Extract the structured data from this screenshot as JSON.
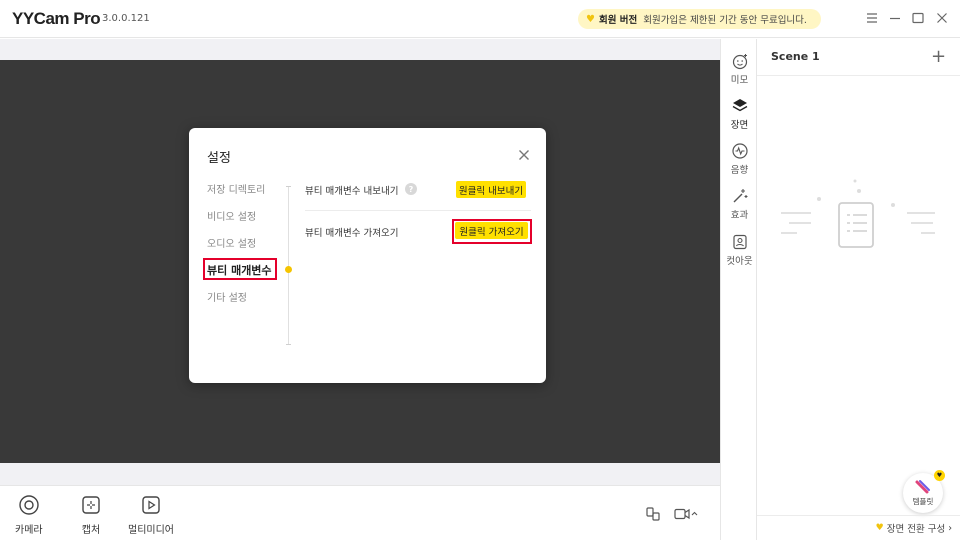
{
  "app": {
    "name": "YYCam Pro",
    "version": "3.0.0.121"
  },
  "banner": {
    "title": "회원 버전",
    "text": "회원가입은 제한된 기간 동안 무료입니다."
  },
  "bottombar": {
    "camera": "카메라",
    "capture": "캡처",
    "multimedia": "멀티미디어"
  },
  "sidenav": {
    "beauty": "미모",
    "scene": "장면",
    "audio": "음향",
    "effects": "효과",
    "cutout": "컷아웃"
  },
  "scene_panel": {
    "title": "Scene 1",
    "add": "+",
    "template_label": "템플릿",
    "footer": "장면 전환 구성"
  },
  "dialog": {
    "title": "설정",
    "menu": [
      "저장 디렉토리",
      "비디오 설정",
      "오디오 설정",
      "뷰티 매개변수",
      "기타 설정"
    ],
    "active_menu_index": 3,
    "export_label": "뷰티 매개변수 내보내기",
    "export_button": "원클릭 내보내기",
    "import_label": "뷰티 매개변수 가져오기",
    "import_button": "원클릭 가져오기",
    "help": "?"
  },
  "colors": {
    "accent_yellow": "#ffe000",
    "highlight_red": "#e4002b",
    "preview_bg": "#393939"
  },
  "icons": {
    "minimize": "minimize-icon",
    "maximize": "maximize-icon",
    "close": "close-icon",
    "menu": "hamburger-menu-icon"
  }
}
